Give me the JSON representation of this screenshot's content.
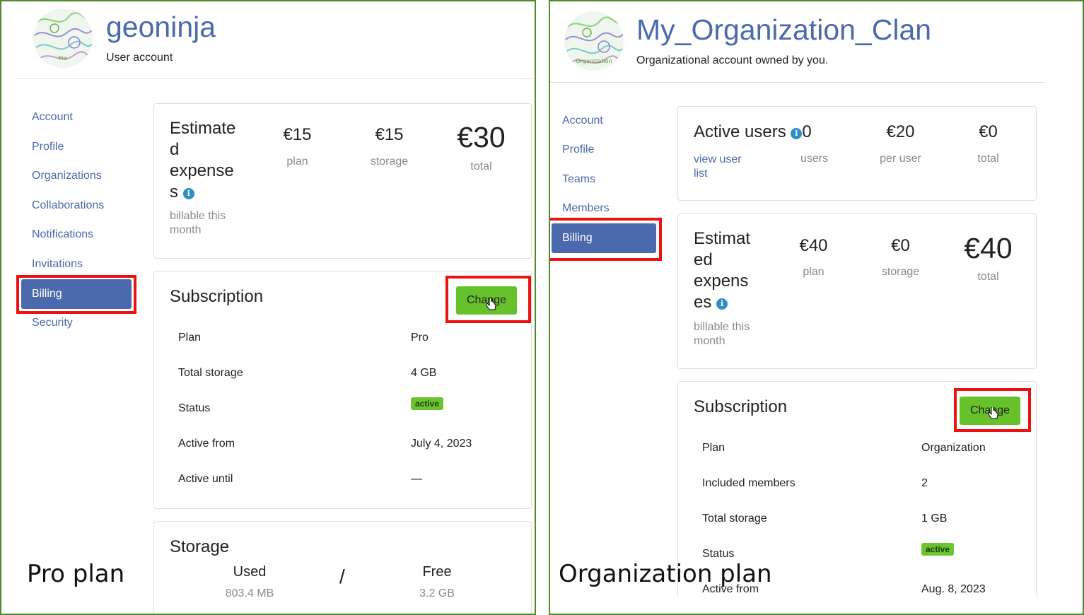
{
  "colors": {
    "accent": "#4b6aad",
    "button": "#67c12b",
    "badge": "#6cc42f",
    "highlight": "#ee1111",
    "frame": "#4f8a2e",
    "info": "#2f8ec7"
  },
  "left": {
    "caption": "Pro plan",
    "avatar_label": "Pro",
    "title": "geoninja",
    "subtitle": "User account",
    "nav": [
      "Account",
      "Profile",
      "Organizations",
      "Collaborations",
      "Notifications",
      "Invitations",
      "Billing",
      "Security"
    ],
    "estimate": {
      "label_lines": [
        "Estimate",
        "d",
        "expense",
        "s"
      ],
      "sub_lines": [
        "billable this",
        "month"
      ],
      "plan_value": "€15",
      "plan_label": "plan",
      "storage_value": "€15",
      "storage_label": "storage",
      "total_value": "€30",
      "total_label": "total",
      "info_icon": "info-icon"
    },
    "subscription": {
      "title": "Subscription",
      "button": "Change",
      "rows": [
        {
          "label": "Plan",
          "value": "Pro"
        },
        {
          "label": "Total storage",
          "value": "4 GB"
        },
        {
          "label": "Status",
          "value": "active"
        },
        {
          "label": "Active from",
          "value": "July 4, 2023"
        },
        {
          "label": "Active until",
          "value": "—"
        }
      ]
    },
    "storage": {
      "title": "Storage",
      "used_label": "Used",
      "used_value": "803.4 MB",
      "divider": "/",
      "free_label": "Free",
      "free_value": "3.2 GB"
    }
  },
  "right": {
    "caption": "Organization plan",
    "avatar_label": "Organization",
    "title": "My_Organization_Clan",
    "subtitle": "Organizational account owned by you.",
    "nav": [
      "Account",
      "Profile",
      "Teams",
      "Members",
      "Billing"
    ],
    "users": {
      "label": "Active users",
      "count": "0",
      "link_lines": [
        "view user",
        "list"
      ],
      "users_label": "users",
      "per_user_value": "€20",
      "per_user_label": "per user",
      "total_value": "€0",
      "total_label": "total"
    },
    "estimate": {
      "label_lines": [
        "Estimat",
        "ed",
        "expens",
        "es"
      ],
      "sub_lines": [
        "billable this",
        "month"
      ],
      "plan_value": "€40",
      "plan_label": "plan",
      "storage_value": "€0",
      "storage_label": "storage",
      "total_value": "€40",
      "total_label": "total"
    },
    "subscription": {
      "title": "Subscription",
      "button": "Change",
      "rows": [
        {
          "label": "Plan",
          "value": "Organization"
        },
        {
          "label": "Included members",
          "value": "2"
        },
        {
          "label": "Total storage",
          "value": "1 GB"
        },
        {
          "label": "Status",
          "value": "active"
        },
        {
          "label": "Active from",
          "value": "Aug. 8, 2023"
        }
      ]
    }
  }
}
